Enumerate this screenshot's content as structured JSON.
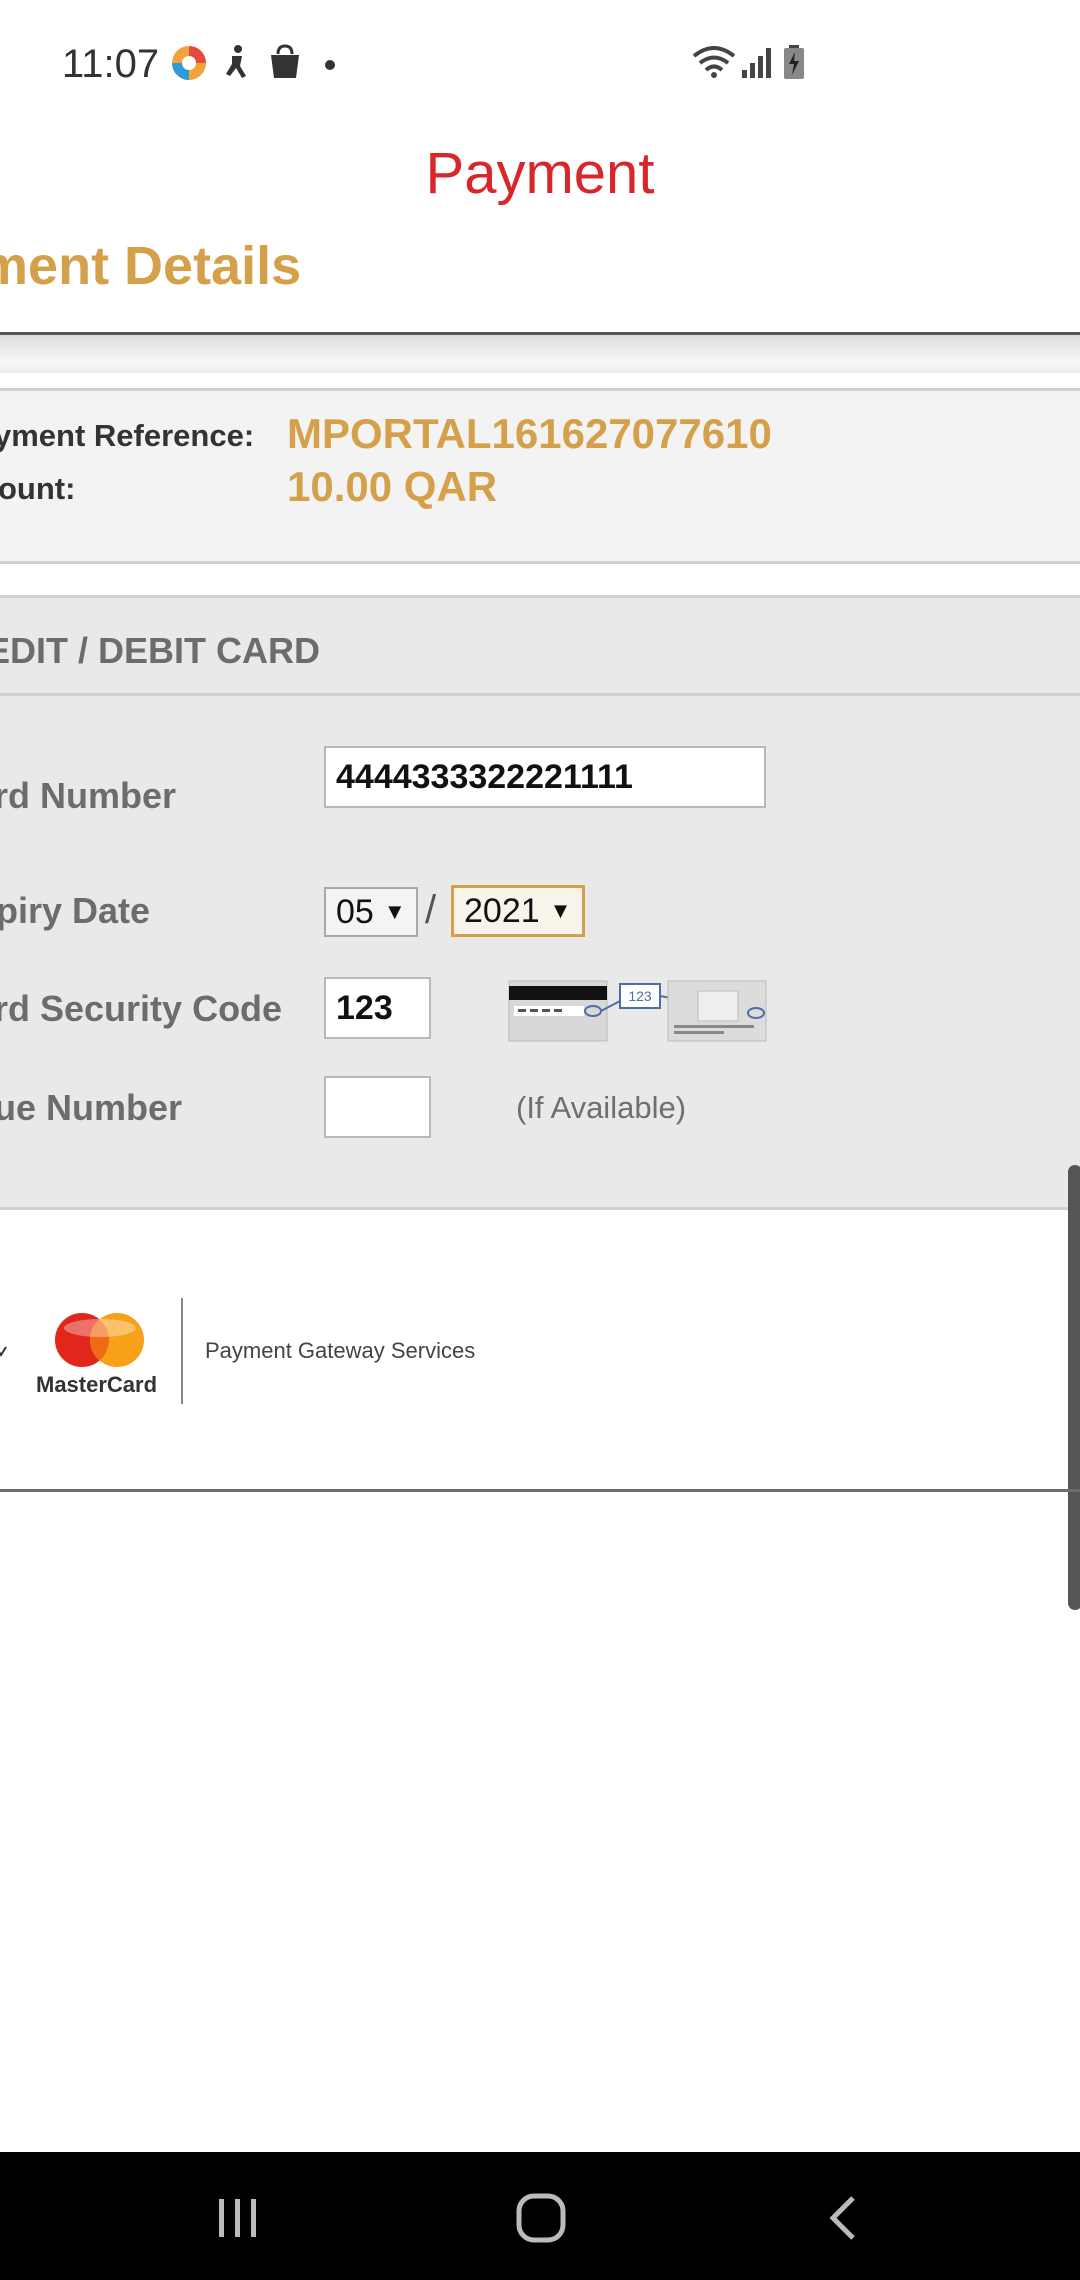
{
  "status_bar": {
    "time": "11:07",
    "left_icons": [
      "app-logo-icon",
      "accessibility-icon",
      "shopping-bag-icon",
      "notification-dot-icon"
    ],
    "right_icons": [
      "wifi-icon",
      "signal-icon",
      "battery-icon"
    ]
  },
  "header": {
    "title": "Payment",
    "subtitle": "yment Details"
  },
  "reference": {
    "payment_reference_label": "yment Reference:",
    "payment_reference_value": "MPORTAL161627077610",
    "amount_label": "ount:",
    "amount_value": "10.00 QAR"
  },
  "card_form": {
    "section_title": "EDIT / DEBIT CARD",
    "card_number_label": "rd Number",
    "card_number_value": "4444333322221111",
    "expiry_label": "piry Date",
    "expiry_month": "05",
    "expiry_separator": "/",
    "expiry_year": "2021",
    "security_code_label": "rd Security Code",
    "security_code_value": "123",
    "security_diagram_text": "123",
    "issue_number_label": "ue Number",
    "issue_number_value": "",
    "issue_hint": "(If Available)"
  },
  "footer": {
    "brand_name": "MasterCard",
    "gateway_text": "Payment Gateway Services",
    "mastercard_colors": [
      "#e2261b",
      "#f7a11b"
    ]
  },
  "nav_bar": {
    "icons": [
      "recent-apps-icon",
      "home-icon",
      "back-icon"
    ]
  },
  "colors": {
    "title": "#d8272b",
    "accent": "#d4a04a",
    "panel": "#e9e9ea"
  }
}
